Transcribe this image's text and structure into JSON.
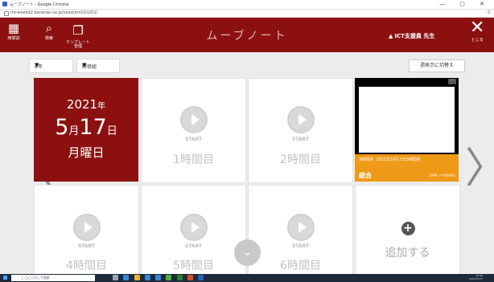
{
  "browser": {
    "tab_title": "ムーブノート - Google Chrome",
    "url": "miraiseed2.benesse.ne.jp/seed/mn010201/",
    "window_controls": "—  ▢  ✕"
  },
  "header": {
    "buttons": [
      {
        "label": "時間割",
        "icon": "calendar-icon"
      },
      {
        "label": "検索",
        "icon": "search-icon"
      },
      {
        "label": "テンプレート\n管理",
        "icon": "template-icon"
      }
    ],
    "title": "ムーブノート",
    "user": "ICT支援員 先生",
    "close_label": "とじる"
  },
  "filters": {
    "grade": "6年",
    "class": "研修組",
    "switch_label": "週表示に切替え"
  },
  "date_card": {
    "year": "2021",
    "year_unit": "年",
    "month": "5",
    "month_unit": "月",
    "day": "17",
    "day_unit": "日",
    "weekday": "月曜日"
  },
  "periods": [
    {
      "start": "START",
      "label": "1時間目"
    },
    {
      "start": "START",
      "label": "2時間目"
    },
    {
      "start": "START",
      "label": "4時間目"
    },
    {
      "start": "START",
      "label": "5時間目"
    },
    {
      "start": "START",
      "label": "6時間目"
    }
  ],
  "video_card": {
    "period": "3時間目",
    "date": "2021年5月17日3時間目",
    "title": "総合",
    "registrant": "記録者：ICT支援員先生"
  },
  "add_card": {
    "label": "追加する"
  },
  "taskbar": {
    "search_placeholder": "ここに入力して検索",
    "time": "16:46",
    "date": "2021/05/17"
  },
  "colors": {
    "brand": "#8c1010",
    "accent": "#ef9a16"
  }
}
